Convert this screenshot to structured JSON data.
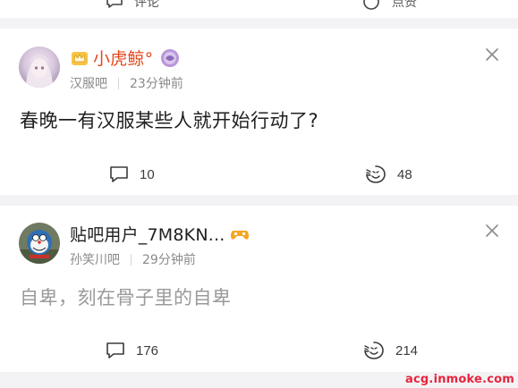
{
  "top_bar": {
    "comment_label": "评论",
    "like_label": "点赞"
  },
  "posts": [
    {
      "username": "小虎鲸°",
      "username_color": "#e1491e",
      "crown_icon": "crown-icon",
      "badge_icon": "member-badge-icon",
      "forum": "汉服吧",
      "time": "23分钟前",
      "content": "春晚一有汉服某些人就开始行动了?",
      "content_color": "#1f1f1f",
      "comments": "10",
      "likes": "48"
    },
    {
      "username": "贴吧用户_7M8KN...",
      "username_color": "#1f1f1f",
      "badge_icon": "gamepad-icon",
      "forum": "孙笑川吧",
      "time": "29分钟前",
      "content": "自卑，刻在骨子里的自卑",
      "content_color": "#9a9a9a",
      "comments": "176",
      "likes": "214"
    }
  ],
  "watermark": "acg.inmoke.com",
  "accent_color": "#e8243d"
}
